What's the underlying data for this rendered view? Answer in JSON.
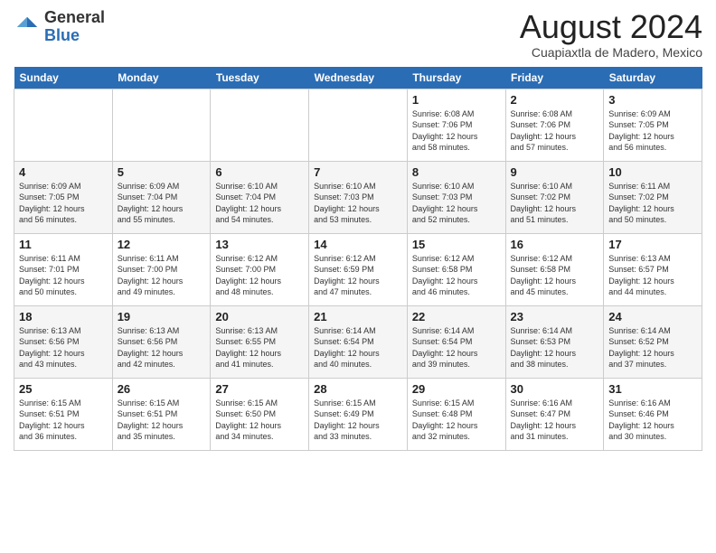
{
  "header": {
    "logo_general": "General",
    "logo_blue": "Blue",
    "month_year": "August 2024",
    "location": "Cuapiaxtla de Madero, Mexico"
  },
  "calendar": {
    "days_of_week": [
      "Sunday",
      "Monday",
      "Tuesday",
      "Wednesday",
      "Thursday",
      "Friday",
      "Saturday"
    ],
    "weeks": [
      [
        {
          "day": "",
          "info": ""
        },
        {
          "day": "",
          "info": ""
        },
        {
          "day": "",
          "info": ""
        },
        {
          "day": "",
          "info": ""
        },
        {
          "day": "1",
          "info": "Sunrise: 6:08 AM\nSunset: 7:06 PM\nDaylight: 12 hours\nand 58 minutes."
        },
        {
          "day": "2",
          "info": "Sunrise: 6:08 AM\nSunset: 7:06 PM\nDaylight: 12 hours\nand 57 minutes."
        },
        {
          "day": "3",
          "info": "Sunrise: 6:09 AM\nSunset: 7:05 PM\nDaylight: 12 hours\nand 56 minutes."
        }
      ],
      [
        {
          "day": "4",
          "info": "Sunrise: 6:09 AM\nSunset: 7:05 PM\nDaylight: 12 hours\nand 56 minutes."
        },
        {
          "day": "5",
          "info": "Sunrise: 6:09 AM\nSunset: 7:04 PM\nDaylight: 12 hours\nand 55 minutes."
        },
        {
          "day": "6",
          "info": "Sunrise: 6:10 AM\nSunset: 7:04 PM\nDaylight: 12 hours\nand 54 minutes."
        },
        {
          "day": "7",
          "info": "Sunrise: 6:10 AM\nSunset: 7:03 PM\nDaylight: 12 hours\nand 53 minutes."
        },
        {
          "day": "8",
          "info": "Sunrise: 6:10 AM\nSunset: 7:03 PM\nDaylight: 12 hours\nand 52 minutes."
        },
        {
          "day": "9",
          "info": "Sunrise: 6:10 AM\nSunset: 7:02 PM\nDaylight: 12 hours\nand 51 minutes."
        },
        {
          "day": "10",
          "info": "Sunrise: 6:11 AM\nSunset: 7:02 PM\nDaylight: 12 hours\nand 50 minutes."
        }
      ],
      [
        {
          "day": "11",
          "info": "Sunrise: 6:11 AM\nSunset: 7:01 PM\nDaylight: 12 hours\nand 50 minutes."
        },
        {
          "day": "12",
          "info": "Sunrise: 6:11 AM\nSunset: 7:00 PM\nDaylight: 12 hours\nand 49 minutes."
        },
        {
          "day": "13",
          "info": "Sunrise: 6:12 AM\nSunset: 7:00 PM\nDaylight: 12 hours\nand 48 minutes."
        },
        {
          "day": "14",
          "info": "Sunrise: 6:12 AM\nSunset: 6:59 PM\nDaylight: 12 hours\nand 47 minutes."
        },
        {
          "day": "15",
          "info": "Sunrise: 6:12 AM\nSunset: 6:58 PM\nDaylight: 12 hours\nand 46 minutes."
        },
        {
          "day": "16",
          "info": "Sunrise: 6:12 AM\nSunset: 6:58 PM\nDaylight: 12 hours\nand 45 minutes."
        },
        {
          "day": "17",
          "info": "Sunrise: 6:13 AM\nSunset: 6:57 PM\nDaylight: 12 hours\nand 44 minutes."
        }
      ],
      [
        {
          "day": "18",
          "info": "Sunrise: 6:13 AM\nSunset: 6:56 PM\nDaylight: 12 hours\nand 43 minutes."
        },
        {
          "day": "19",
          "info": "Sunrise: 6:13 AM\nSunset: 6:56 PM\nDaylight: 12 hours\nand 42 minutes."
        },
        {
          "day": "20",
          "info": "Sunrise: 6:13 AM\nSunset: 6:55 PM\nDaylight: 12 hours\nand 41 minutes."
        },
        {
          "day": "21",
          "info": "Sunrise: 6:14 AM\nSunset: 6:54 PM\nDaylight: 12 hours\nand 40 minutes."
        },
        {
          "day": "22",
          "info": "Sunrise: 6:14 AM\nSunset: 6:54 PM\nDaylight: 12 hours\nand 39 minutes."
        },
        {
          "day": "23",
          "info": "Sunrise: 6:14 AM\nSunset: 6:53 PM\nDaylight: 12 hours\nand 38 minutes."
        },
        {
          "day": "24",
          "info": "Sunrise: 6:14 AM\nSunset: 6:52 PM\nDaylight: 12 hours\nand 37 minutes."
        }
      ],
      [
        {
          "day": "25",
          "info": "Sunrise: 6:15 AM\nSunset: 6:51 PM\nDaylight: 12 hours\nand 36 minutes."
        },
        {
          "day": "26",
          "info": "Sunrise: 6:15 AM\nSunset: 6:51 PM\nDaylight: 12 hours\nand 35 minutes."
        },
        {
          "day": "27",
          "info": "Sunrise: 6:15 AM\nSunset: 6:50 PM\nDaylight: 12 hours\nand 34 minutes."
        },
        {
          "day": "28",
          "info": "Sunrise: 6:15 AM\nSunset: 6:49 PM\nDaylight: 12 hours\nand 33 minutes."
        },
        {
          "day": "29",
          "info": "Sunrise: 6:15 AM\nSunset: 6:48 PM\nDaylight: 12 hours\nand 32 minutes."
        },
        {
          "day": "30",
          "info": "Sunrise: 6:16 AM\nSunset: 6:47 PM\nDaylight: 12 hours\nand 31 minutes."
        },
        {
          "day": "31",
          "info": "Sunrise: 6:16 AM\nSunset: 6:46 PM\nDaylight: 12 hours\nand 30 minutes."
        }
      ]
    ]
  }
}
